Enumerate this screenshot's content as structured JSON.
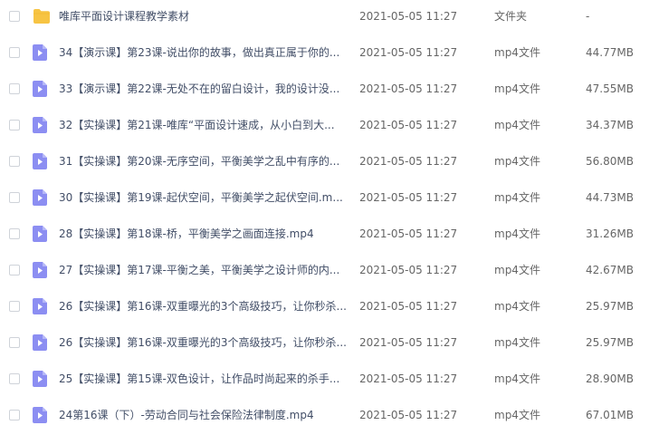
{
  "files": [
    {
      "icon": "folder-icon",
      "name": "唯库平面设计课程教学素材",
      "modified": "2021-05-05 11:27",
      "type": "文件夹",
      "size": "-"
    },
    {
      "icon": "video-file-icon",
      "name": "34【演示课】第23课-说出你的故事，做出真正属于你的...",
      "modified": "2021-05-05 11:27",
      "type": "mp4文件",
      "size": "44.77MB"
    },
    {
      "icon": "video-file-icon",
      "name": "33【演示课】第22课-无处不在的留白设计，我的设计没...",
      "modified": "2021-05-05 11:27",
      "type": "mp4文件",
      "size": "47.55MB"
    },
    {
      "icon": "video-file-icon",
      "name": "32【实操课】第21课-唯库“平面设计速成，从小白到大...",
      "modified": "2021-05-05 11:27",
      "type": "mp4文件",
      "size": "34.37MB"
    },
    {
      "icon": "video-file-icon",
      "name": "31【实操课】第20课-无序空间，平衡美学之乱中有序的...",
      "modified": "2021-05-05 11:27",
      "type": "mp4文件",
      "size": "56.80MB"
    },
    {
      "icon": "video-file-icon",
      "name": "30【实操课】第19课-起伏空间，平衡美学之起伏空间.m...",
      "modified": "2021-05-05 11:27",
      "type": "mp4文件",
      "size": "44.73MB"
    },
    {
      "icon": "video-file-icon",
      "name": "28【实操课】第18课-桥，平衡美学之画面连接.mp4",
      "modified": "2021-05-05 11:27",
      "type": "mp4文件",
      "size": "31.26MB"
    },
    {
      "icon": "video-file-icon",
      "name": "27【实操课】第17课-平衡之美，平衡美学之设计师的内...",
      "modified": "2021-05-05 11:27",
      "type": "mp4文件",
      "size": "42.67MB"
    },
    {
      "icon": "video-file-icon",
      "name": "26【实操课】第16课-双重曝光的3个高级技巧，让你秒杀...",
      "modified": "2021-05-05 11:27",
      "type": "mp4文件",
      "size": "25.97MB"
    },
    {
      "icon": "video-file-icon",
      "name": "26【实操课】第16课-双重曝光的3个高级技巧，让你秒杀...",
      "modified": "2021-05-05 11:27",
      "type": "mp4文件",
      "size": "25.97MB"
    },
    {
      "icon": "video-file-icon",
      "name": "25【实操课】第15课-双色设计，让作品时尚起来的杀手...",
      "modified": "2021-05-05 11:27",
      "type": "mp4文件",
      "size": "28.90MB"
    },
    {
      "icon": "video-file-icon",
      "name": "24第16课（下）-劳动合同与社会保险法律制度.mp4",
      "modified": "2021-05-05 11:27",
      "type": "mp4文件",
      "size": "67.01MB"
    }
  ],
  "colors": {
    "folder": "#f7c443",
    "video_icon_bg": "#8c8ef2",
    "video_icon_play": "#ffffff",
    "name_text": "#424e67",
    "meta_text": "#666666",
    "checkbox_border": "#cfd3d9"
  }
}
